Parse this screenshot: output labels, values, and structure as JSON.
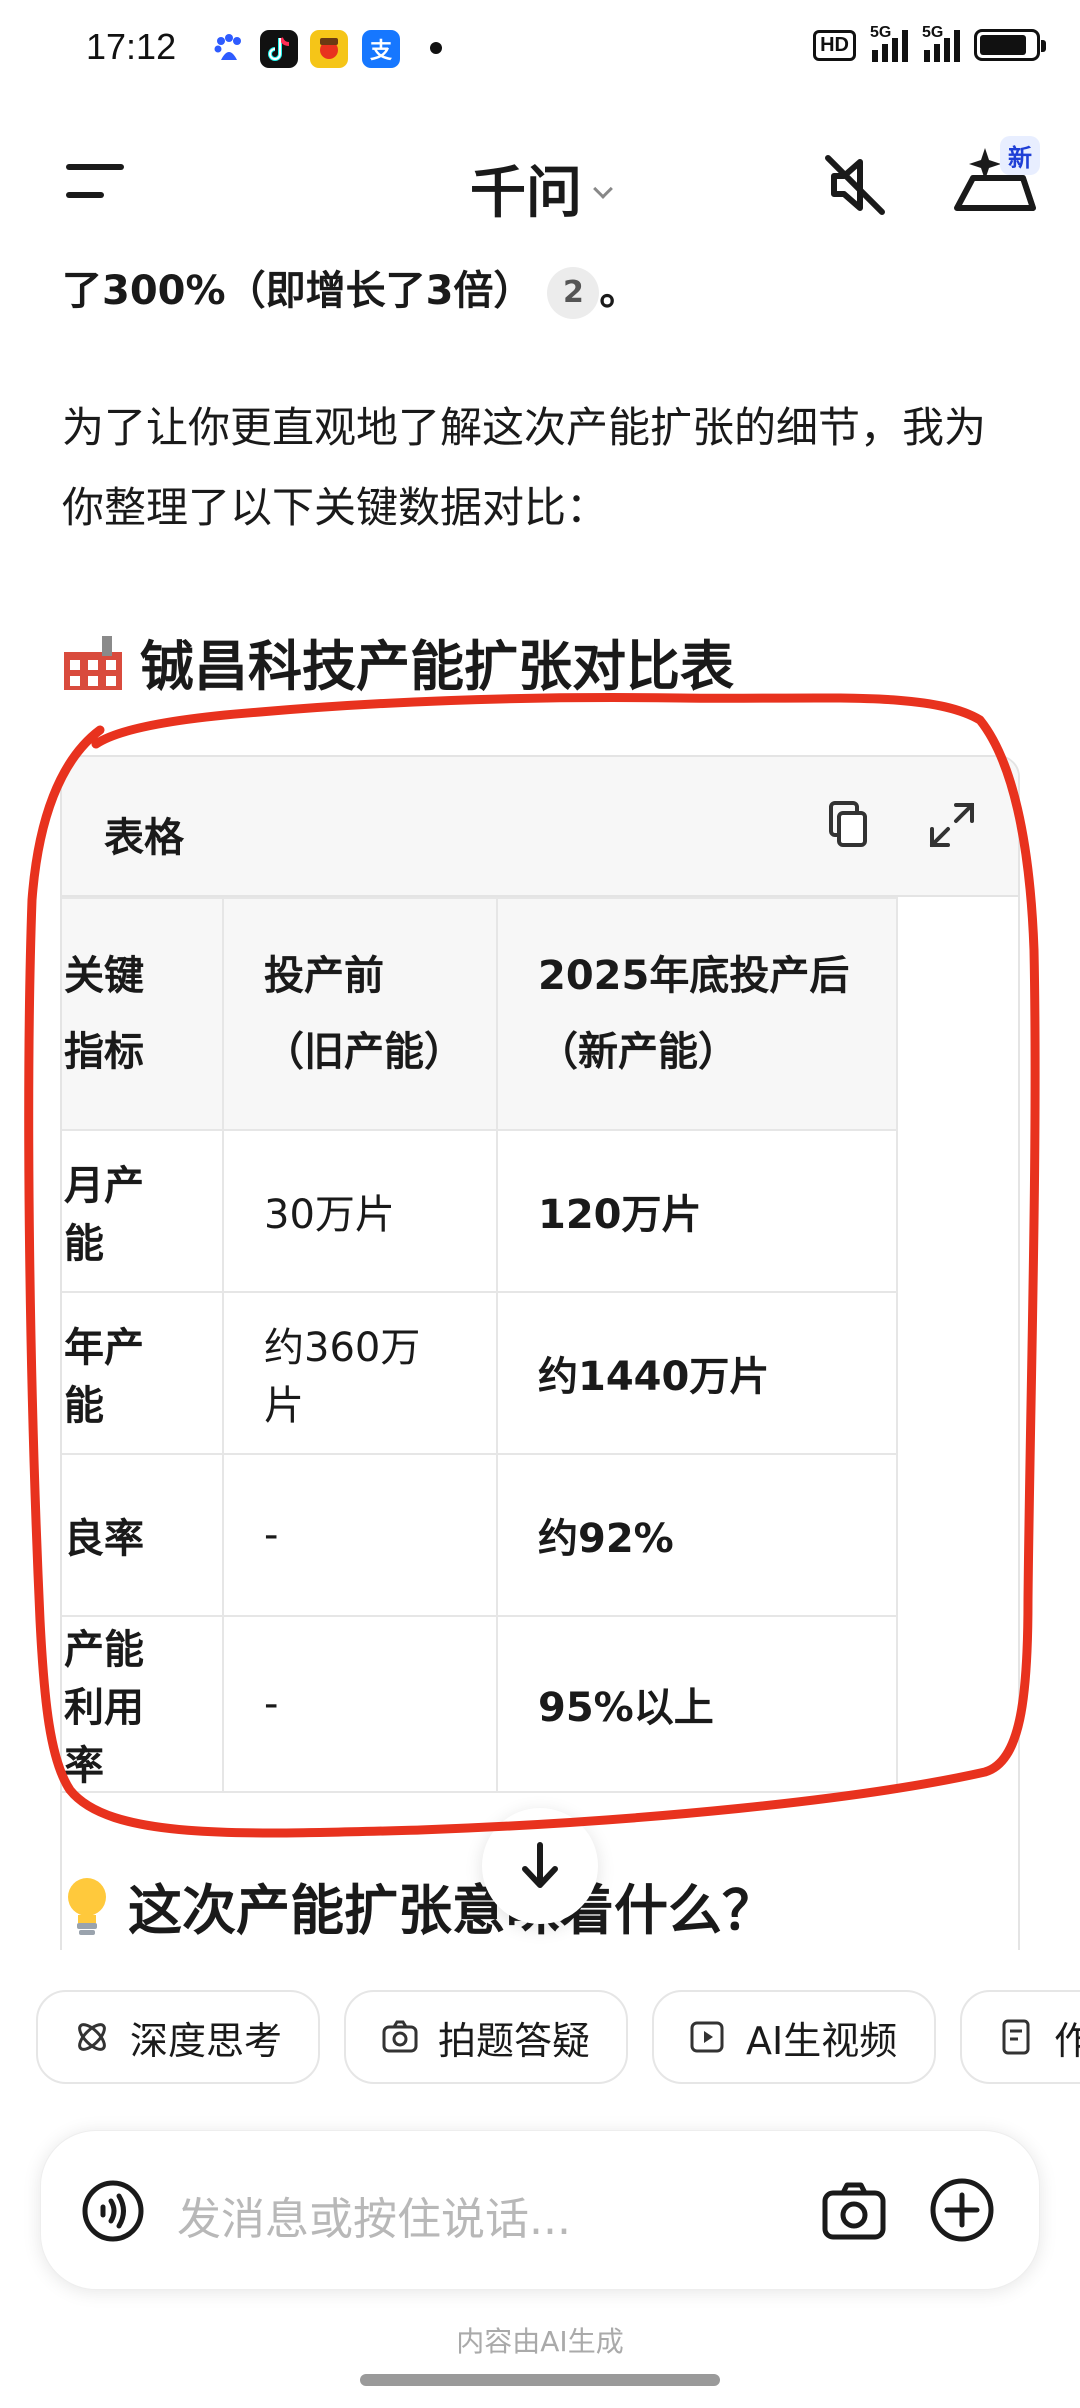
{
  "status_bar": {
    "time": "17:12",
    "hd_label": "HD",
    "signal1_label": "5G",
    "signal2_label": "5G",
    "battery_level": 0.85,
    "app_icons": [
      "baidu-icon",
      "tiktok-icon",
      "game-icon",
      "alipay-icon"
    ]
  },
  "header": {
    "title": "千问",
    "new_badge": "新"
  },
  "message": {
    "partial_line": "了300%（即增长了3倍）",
    "citation": "2",
    "partial_line_end": "。",
    "paragraph": "为了让你更直观地了解这次产能扩张的细节，我为你整理了以下关键数据对比：",
    "section_title": "铖昌科技产能扩张对比表",
    "section2_title": "这次产能扩张意味着什么？"
  },
  "table": {
    "label": "表格",
    "headers": [
      "关键指标",
      "投产前（旧产能）",
      "2025年底投产后（新产能）"
    ],
    "rows": [
      [
        "月产能",
        "30万片",
        "120万片"
      ],
      [
        "年产能",
        "约360万片",
        "约1440万片"
      ],
      [
        "良率",
        "-",
        "约92%"
      ],
      [
        "产能利用率",
        "-",
        "95%以上"
      ]
    ]
  },
  "chips": [
    "深度思考",
    "拍题答疑",
    "AI生视频",
    "作"
  ],
  "input": {
    "placeholder": "发消息或按住说话..."
  },
  "footer": {
    "disclaimer": "内容由AI生成"
  },
  "colors": {
    "annotation_red": "#e8321e",
    "accent_blue": "#1f3fd6"
  }
}
